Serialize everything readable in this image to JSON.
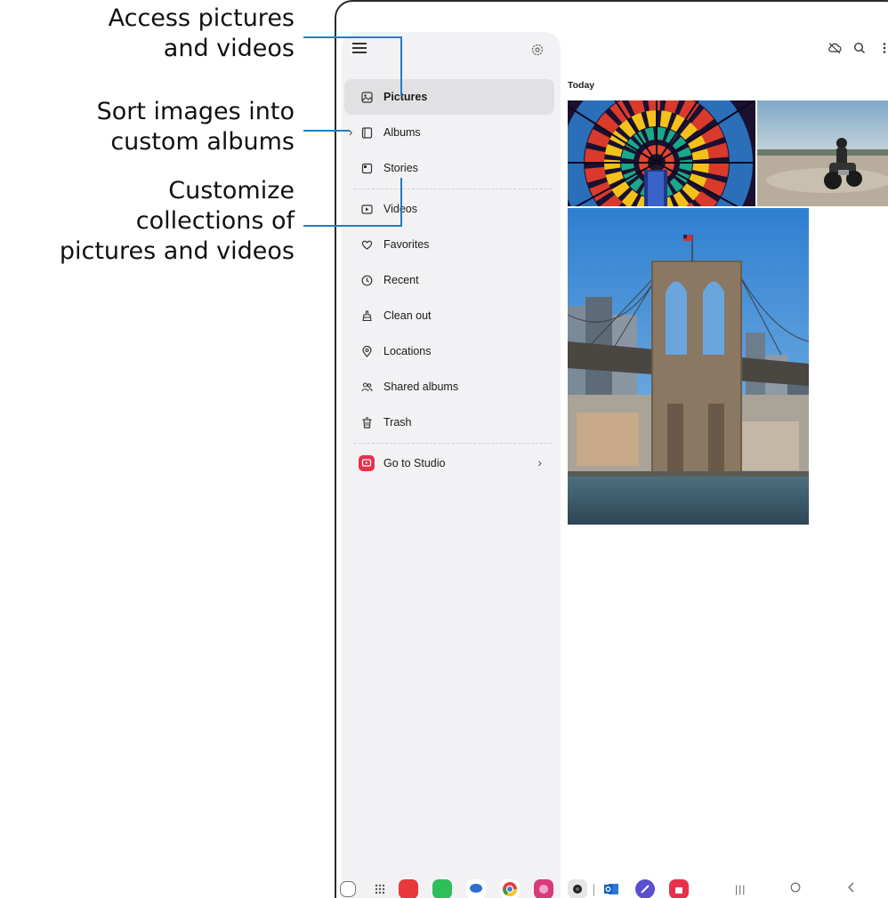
{
  "callouts": [
    {
      "lines": [
        "Access pictures",
        "and videos"
      ]
    },
    {
      "lines": [
        "Sort images into",
        "custom albums"
      ]
    },
    {
      "lines": [
        "Customize",
        "collections of",
        "pictures and videos"
      ]
    }
  ],
  "drawer": {
    "items": [
      {
        "label": "Pictures",
        "icon": "image-icon",
        "active": true
      },
      {
        "label": "Albums",
        "icon": "album-icon",
        "expandable": true
      },
      {
        "label": "Stories",
        "icon": "stories-icon"
      },
      {
        "label": "Videos",
        "icon": "video-icon"
      },
      {
        "label": "Favorites",
        "icon": "heart-icon"
      },
      {
        "label": "Recent",
        "icon": "clock-icon"
      },
      {
        "label": "Clean out",
        "icon": "brush-icon"
      },
      {
        "label": "Locations",
        "icon": "location-pin-icon"
      },
      {
        "label": "Shared albums",
        "icon": "people-icon"
      },
      {
        "label": "Trash",
        "icon": "trash-icon"
      }
    ],
    "studio": {
      "label": "Go to Studio",
      "icon": "studio-icon"
    }
  },
  "main": {
    "section_label": "Today",
    "photos": [
      {
        "name": "colorful-ceiling-photo"
      },
      {
        "name": "motorcycle-desert-photo"
      },
      {
        "name": "brooklyn-bridge-photo"
      }
    ],
    "toolbar_icons": [
      "cloud-off-icon",
      "search-icon",
      "more-vert-icon"
    ]
  },
  "taskbar": {
    "apps": [
      "recent-apps-icon",
      "app-drawer-icon",
      "notes-app-icon",
      "phone-app-icon",
      "messages-app-icon",
      "chrome-app-icon",
      "gallery-app-icon",
      "camera-app-icon",
      "outlook-app-icon",
      "browser-app-icon",
      "store-app-icon"
    ],
    "nav": [
      "recents-nav-button",
      "home-nav-button",
      "back-nav-button"
    ]
  },
  "colors": {
    "callout_line": "#1d7fc3",
    "drawer_bg": "#f2f2f4",
    "active_item_bg": "#e1e1e3",
    "studio_accent": "#e8304a"
  }
}
